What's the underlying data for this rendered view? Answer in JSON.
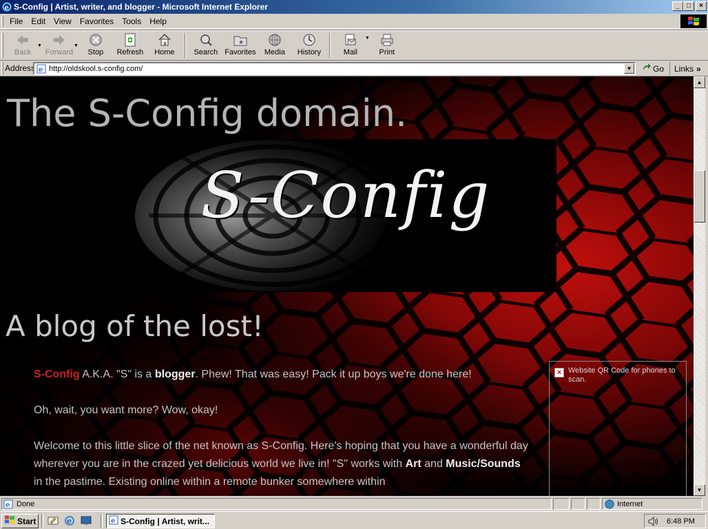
{
  "window": {
    "title": "S-Config | Artist, writer, and blogger - Microsoft Internet Explorer",
    "controls": {
      "minimize": "_",
      "maximize": "□",
      "close": "×"
    }
  },
  "menu": [
    "File",
    "Edit",
    "View",
    "Favorites",
    "Tools",
    "Help"
  ],
  "toolbar": {
    "back": "Back",
    "forward": "Forward",
    "stop": "Stop",
    "refresh": "Refresh",
    "home": "Home",
    "search": "Search",
    "favorites": "Favorites",
    "media": "Media",
    "history": "History",
    "mail": "Mail",
    "print": "Print"
  },
  "address": {
    "label": "Address",
    "url": "http://oldskool.s-config.com/",
    "go": "Go",
    "links": "Links"
  },
  "page": {
    "title": "The S-Config domain.",
    "banner_text": "S-Config",
    "heading": "A blog of the lost!",
    "para1": {
      "brand": "S-Config",
      "t1": " A.K.A. \"S\" is a ",
      "bold": "blogger",
      "t2": ". Phew! That was easy! Pack it up boys we're done here!"
    },
    "para2": "Oh, wait, you want more? Wow, okay!",
    "para3": {
      "t1": "Welcome to this little slice of the net known as S-Config. Here's hoping that you have a wonderful day wherever you are in the crazed yet delicious world we live in! \"S\" works with ",
      "bold1": "Art",
      "t2": " and ",
      "bold2": "Music/Sounds",
      "t3": " in the pastime. Existing online within a remote bunker somewhere within"
    },
    "qr_alt": "Website QR Code for phones to scan."
  },
  "status": {
    "text": "Done",
    "zone": "Internet"
  },
  "taskbar": {
    "start": "Start",
    "task": "S-Config | Artist, writ...",
    "clock": "6:48 PM"
  },
  "colors": {
    "brand_red": "#c8211e",
    "title_gray": "#b4b4b4",
    "hex_red": "#9a0c0c"
  }
}
